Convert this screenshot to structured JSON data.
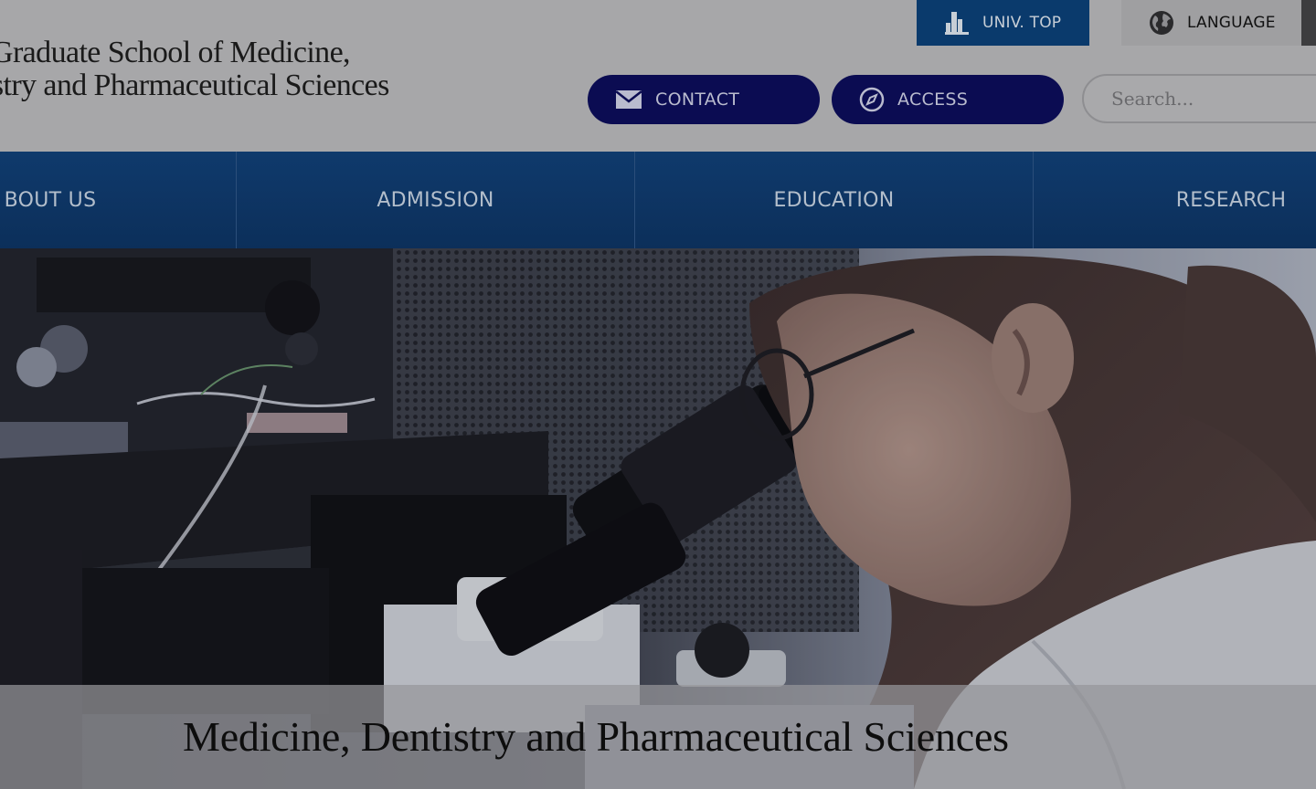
{
  "header": {
    "title_line1": "Graduate School of Medicine,",
    "title_line2": "istry and Pharmaceutical Sciences",
    "univ_top_label": "UNIV. TOP",
    "language_label": "LANGUAGE",
    "contact_label": "CONTACT",
    "access_label": "ACCESS",
    "search_placeholder": "Search..."
  },
  "nav": {
    "items": [
      {
        "label": "BOUT US"
      },
      {
        "label": "ADMISSION"
      },
      {
        "label": "EDUCATION"
      },
      {
        "label": "RESEARCH"
      }
    ]
  },
  "hero": {
    "caption": "Medicine, Dentistry and Pharmaceutical Sciences"
  },
  "colors": {
    "nav_blue": "#0f3a6c",
    "pill_navy": "#0b0c52",
    "header_gray": "#a7a7a9"
  },
  "icons": {
    "univ_top": "building-icon",
    "language": "globe-icon",
    "contact": "envelope-icon",
    "access": "compass-icon"
  }
}
